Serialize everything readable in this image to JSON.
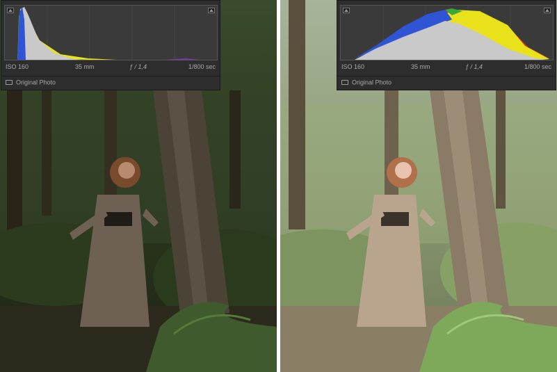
{
  "left": {
    "iso": "ISO 160",
    "focal_length": "35 mm",
    "aperture": "ƒ / 1,4",
    "shutter": "1/800 sec",
    "original_photo_label": "Original Photo"
  },
  "right": {
    "iso": "ISO 160",
    "focal_length": "35 mm",
    "aperture": "ƒ / 1,4",
    "shutter": "1/800 sec",
    "original_photo_label": "Original Photo"
  },
  "colors": {
    "panel_bg": "#2d2d2d",
    "histogram_bg": "#3a3a3a",
    "hist_gray": "#c9c9c9",
    "hist_blue": "#2f54d6",
    "hist_yellow": "#e9e21a",
    "hist_green": "#3aa837",
    "hist_red": "#c83a2a",
    "divider": "#ffffff"
  }
}
